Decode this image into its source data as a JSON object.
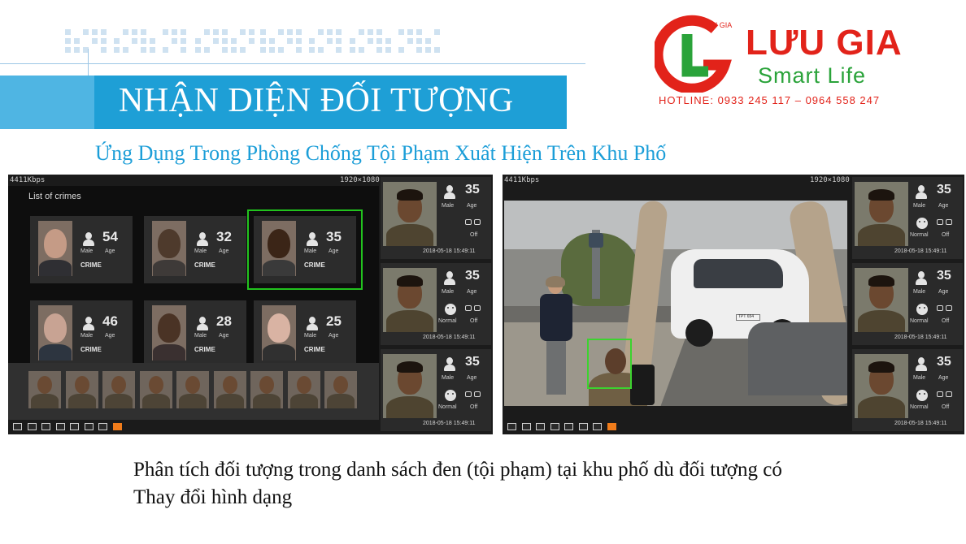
{
  "slide": {
    "title": "NHẬN DIỆN ĐỐI TƯỢNG",
    "subtitle": "Ứng Dụng Trong Phòng Chống Tội Phạm Xuất Hiện Trên Khu Phố",
    "caption_line1": "Phân tích đối tượng trong danh sách đen (tội phạm) tại khu phố dù đối tượng có",
    "caption_line2": "Thay đổi hình dạng"
  },
  "logo": {
    "name": "LƯU GIA",
    "tagline": "Smart Life",
    "mark_text": "LƯU GIA",
    "hotline": "HOTLINE: 0933 245 117 – 0964 558 247",
    "colors": {
      "red": "#e2231a",
      "green": "#2aa33a"
    }
  },
  "left_screen": {
    "bitrate": "4411Kbps",
    "resolution": "1920×1080",
    "list_title": "List of crimes",
    "crimes": [
      {
        "age": "54",
        "gender": "Male",
        "age_label": "Age",
        "tag": "CRIME",
        "selected": false
      },
      {
        "age": "32",
        "gender": "Male",
        "age_label": "Age",
        "tag": "CRIME",
        "selected": false
      },
      {
        "age": "35",
        "gender": "Male",
        "age_label": "Age",
        "tag": "CRIME",
        "selected": true
      },
      {
        "age": "46",
        "gender": "Male",
        "age_label": "Age",
        "tag": "CRIME",
        "selected": false
      },
      {
        "age": "28",
        "gender": "Male",
        "age_label": "Age",
        "tag": "CRIME",
        "selected": false
      },
      {
        "age": "25",
        "gender": "Male",
        "age_label": "Age",
        "tag": "CRIME",
        "selected": false
      }
    ],
    "side_cards": [
      {
        "age": "35",
        "gender": "Male",
        "age_label": "Age",
        "expression": "",
        "glasses": "Off",
        "time": "2018-05-18 15:49:11"
      },
      {
        "age": "35",
        "gender": "Male",
        "age_label": "Age",
        "expression": "Normal",
        "glasses": "Off",
        "time": "2018-05-18 15:49:11"
      },
      {
        "age": "35",
        "gender": "Male",
        "age_label": "Age",
        "expression": "Normal",
        "glasses": "Off",
        "time": "2018-05-18 15:49:11"
      }
    ]
  },
  "right_screen": {
    "bitrate": "4411Kbps",
    "resolution": "1920×1080",
    "plate": "TPT 654",
    "side_cards": [
      {
        "age": "35",
        "gender": "Male",
        "age_label": "Age",
        "expression": "Normal",
        "glasses": "Off",
        "time": "2018-05-18 15:49:11"
      },
      {
        "age": "35",
        "gender": "Male",
        "age_label": "Age",
        "expression": "Normal",
        "glasses": "Off",
        "time": "2018-05-18 15:49:11"
      },
      {
        "age": "35",
        "gender": "Male",
        "age_label": "Age",
        "expression": "Normal",
        "glasses": "Off",
        "time": "2018-05-18 15:49:11"
      }
    ]
  }
}
